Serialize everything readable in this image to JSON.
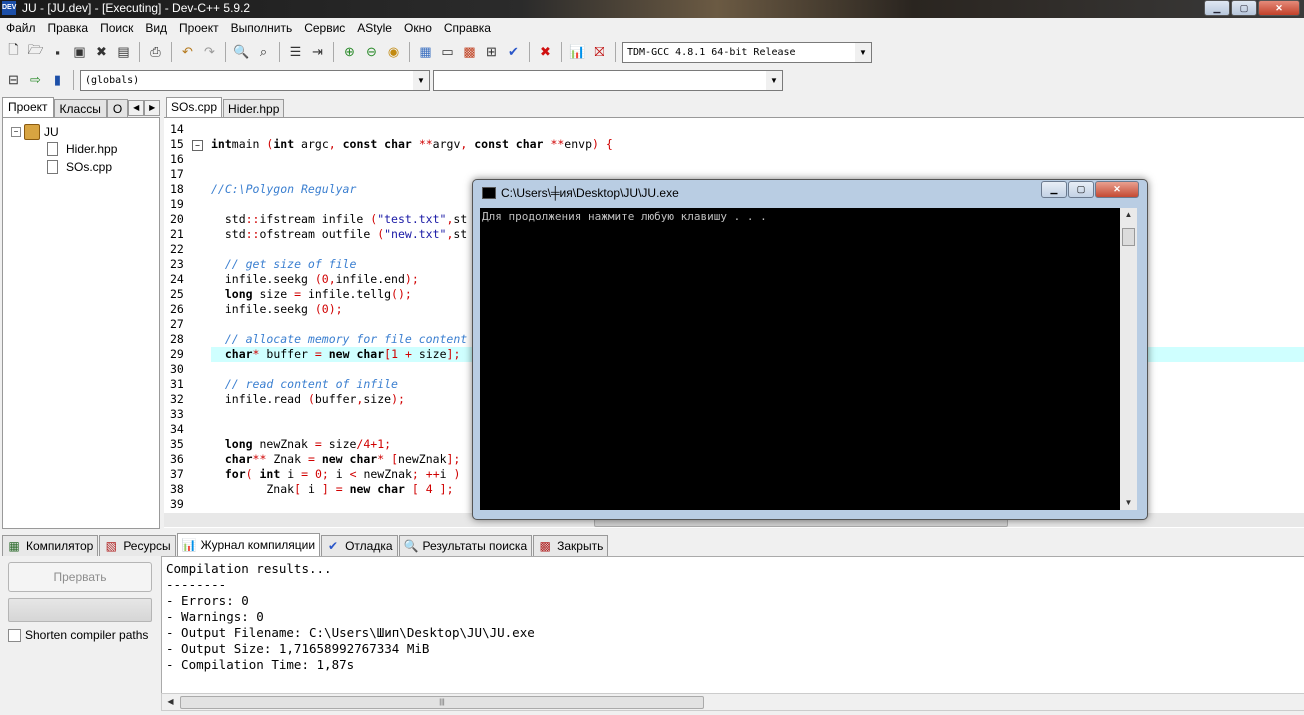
{
  "window": {
    "title": "JU - [JU.dev] - [Executing] - Dev-C++ 5.9.2",
    "app_icon_label": "DEV"
  },
  "menu": [
    "Файл",
    "Правка",
    "Поиск",
    "Вид",
    "Проект",
    "Выполнить",
    "Сервис",
    "AStyle",
    "Окно",
    "Справка"
  ],
  "toolbar": {
    "compiler_select": "TDM-GCC 4.8.1 64-bit Release",
    "scope_select": "(globals)",
    "member_select": ""
  },
  "left_panel": {
    "tabs": [
      "Проект",
      "Классы",
      "О"
    ],
    "project": "JU",
    "files": [
      "Hider.hpp",
      "SOs.cpp"
    ]
  },
  "editor": {
    "tabs": [
      "SOs.cpp",
      "Hider.hpp"
    ],
    "lines": [
      {
        "n": "14",
        "segs": []
      },
      {
        "n": "15",
        "segs": [
          [
            "kw",
            "int"
          ],
          [
            "",
            "main "
          ],
          [
            "sym",
            "("
          ],
          [
            "kw",
            "int"
          ],
          [
            "",
            " argc"
          ],
          [
            "sym",
            ","
          ],
          [
            "",
            " "
          ],
          [
            "kw",
            "const char"
          ],
          [
            "",
            " "
          ],
          [
            "sym",
            "**"
          ],
          [
            "",
            "argv"
          ],
          [
            "sym",
            ","
          ],
          [
            "",
            " "
          ],
          [
            "kw",
            "const char"
          ],
          [
            "",
            " "
          ],
          [
            "sym",
            "**"
          ],
          [
            "",
            "envp"
          ],
          [
            "sym",
            ") {"
          ]
        ]
      },
      {
        "n": "16",
        "segs": []
      },
      {
        "n": "17",
        "segs": []
      },
      {
        "n": "18",
        "segs": [
          [
            "cmt",
            "//C:\\Polygon Regulyar"
          ]
        ]
      },
      {
        "n": "19",
        "segs": []
      },
      {
        "n": "20",
        "segs": [
          [
            "",
            "  std"
          ],
          [
            "sym",
            "::"
          ],
          [
            "",
            "ifstream infile "
          ],
          [
            "sym",
            "("
          ],
          [
            "str",
            "\"test.txt\""
          ],
          [
            "sym",
            ","
          ],
          [
            "",
            "st"
          ]
        ]
      },
      {
        "n": "21",
        "segs": [
          [
            "",
            "  std"
          ],
          [
            "sym",
            "::"
          ],
          [
            "",
            "ofstream outfile "
          ],
          [
            "sym",
            "("
          ],
          [
            "str",
            "\"new.txt\""
          ],
          [
            "sym",
            ","
          ],
          [
            "",
            "st"
          ]
        ]
      },
      {
        "n": "22",
        "segs": []
      },
      {
        "n": "23",
        "segs": [
          [
            "cmt",
            "  // get size of file"
          ]
        ]
      },
      {
        "n": "24",
        "segs": [
          [
            "",
            "  infile.seekg "
          ],
          [
            "sym",
            "("
          ],
          [
            "num",
            "0"
          ],
          [
            "sym",
            ","
          ],
          [
            "",
            "infile.end"
          ],
          [
            "sym",
            ");"
          ]
        ]
      },
      {
        "n": "25",
        "segs": [
          [
            "kw",
            "  long"
          ],
          [
            "",
            " size "
          ],
          [
            "sym",
            "="
          ],
          [
            "",
            " infile.tellg"
          ],
          [
            "sym",
            "();"
          ]
        ]
      },
      {
        "n": "26",
        "segs": [
          [
            "",
            "  infile.seekg "
          ],
          [
            "sym",
            "("
          ],
          [
            "num",
            "0"
          ],
          [
            "sym",
            ");"
          ]
        ]
      },
      {
        "n": "27",
        "segs": []
      },
      {
        "n": "28",
        "segs": [
          [
            "cmt",
            "  // allocate memory for file content"
          ]
        ]
      },
      {
        "n": "29",
        "segs": [
          [
            "kw",
            "  char"
          ],
          [
            "sym",
            "*"
          ],
          [
            "",
            " buffer "
          ],
          [
            "sym",
            "="
          ],
          [
            "",
            " "
          ],
          [
            "kw",
            "new char"
          ],
          [
            "sym",
            "["
          ],
          [
            "num",
            "1"
          ],
          [
            "",
            " "
          ],
          [
            "sym",
            "+"
          ],
          [
            "",
            " size"
          ],
          [
            "sym",
            "];"
          ]
        ]
      },
      {
        "n": "30",
        "segs": []
      },
      {
        "n": "31",
        "segs": [
          [
            "cmt",
            "  // read content of infile"
          ]
        ]
      },
      {
        "n": "32",
        "segs": [
          [
            "",
            "  infile.read "
          ],
          [
            "sym",
            "("
          ],
          [
            "",
            "buffer"
          ],
          [
            "sym",
            ","
          ],
          [
            "",
            "size"
          ],
          [
            "sym",
            ");"
          ]
        ]
      },
      {
        "n": "33",
        "segs": []
      },
      {
        "n": "34",
        "segs": []
      },
      {
        "n": "35",
        "segs": [
          [
            "kw",
            "  long"
          ],
          [
            "",
            " newZnak "
          ],
          [
            "sym",
            "="
          ],
          [
            "",
            " size"
          ],
          [
            "sym",
            "/"
          ],
          [
            "num",
            "4"
          ],
          [
            "sym",
            "+"
          ],
          [
            "num",
            "1"
          ],
          [
            "sym",
            ";"
          ]
        ]
      },
      {
        "n": "36",
        "segs": [
          [
            "kw",
            "  char"
          ],
          [
            "sym",
            "**"
          ],
          [
            "",
            " Znak "
          ],
          [
            "sym",
            "="
          ],
          [
            "",
            " "
          ],
          [
            "kw",
            "new char"
          ],
          [
            "sym",
            "*"
          ],
          [
            "",
            " "
          ],
          [
            "sym",
            "["
          ],
          [
            "",
            "newZnak"
          ],
          [
            "sym",
            "];"
          ]
        ]
      },
      {
        "n": "37",
        "segs": [
          [
            "kw",
            "  for"
          ],
          [
            "sym",
            "("
          ],
          [
            "",
            " "
          ],
          [
            "kw",
            "int"
          ],
          [
            "",
            " i "
          ],
          [
            "sym",
            "="
          ],
          [
            "",
            " "
          ],
          [
            "num",
            "0"
          ],
          [
            "sym",
            ";"
          ],
          [
            "",
            " i "
          ],
          [
            "sym",
            "<"
          ],
          [
            "",
            " newZnak"
          ],
          [
            "sym",
            ";"
          ],
          [
            "",
            " "
          ],
          [
            "sym",
            "++"
          ],
          [
            "",
            "i "
          ],
          [
            "sym",
            ")"
          ]
        ]
      },
      {
        "n": "38",
        "segs": [
          [
            "",
            "        Znak"
          ],
          [
            "sym",
            "["
          ],
          [
            "",
            " i "
          ],
          [
            "sym",
            "]"
          ],
          [
            "",
            " "
          ],
          [
            "sym",
            "="
          ],
          [
            "",
            " "
          ],
          [
            "kw",
            "new char"
          ],
          [
            "",
            " "
          ],
          [
            "sym",
            "["
          ],
          [
            "",
            " "
          ],
          [
            "num",
            "4"
          ],
          [
            "",
            " "
          ],
          [
            "sym",
            "];"
          ]
        ]
      },
      {
        "n": "39",
        "segs": []
      }
    ]
  },
  "console": {
    "title": "C:\\Users\\╪ия\\Desktop\\JU\\JU.exe",
    "text": "Для продолжения нажмите любую клавишу . . ."
  },
  "bottom": {
    "tabs": [
      "Компилятор",
      "Ресурсы",
      "Журнал компиляции",
      "Отладка",
      "Результаты поиска",
      "Закрыть"
    ],
    "abort_label": "Прервать",
    "shorten_label": "Shorten compiler paths",
    "log": [
      "Compilation results...",
      "--------",
      "- Errors: 0",
      "- Warnings: 0",
      "- Output Filename: C:\\Users\\Шип\\Desktop\\JU\\JU.exe",
      "- Output Size: 1,71658992767334 MiB",
      "- Compilation Time: 1,87s"
    ]
  }
}
